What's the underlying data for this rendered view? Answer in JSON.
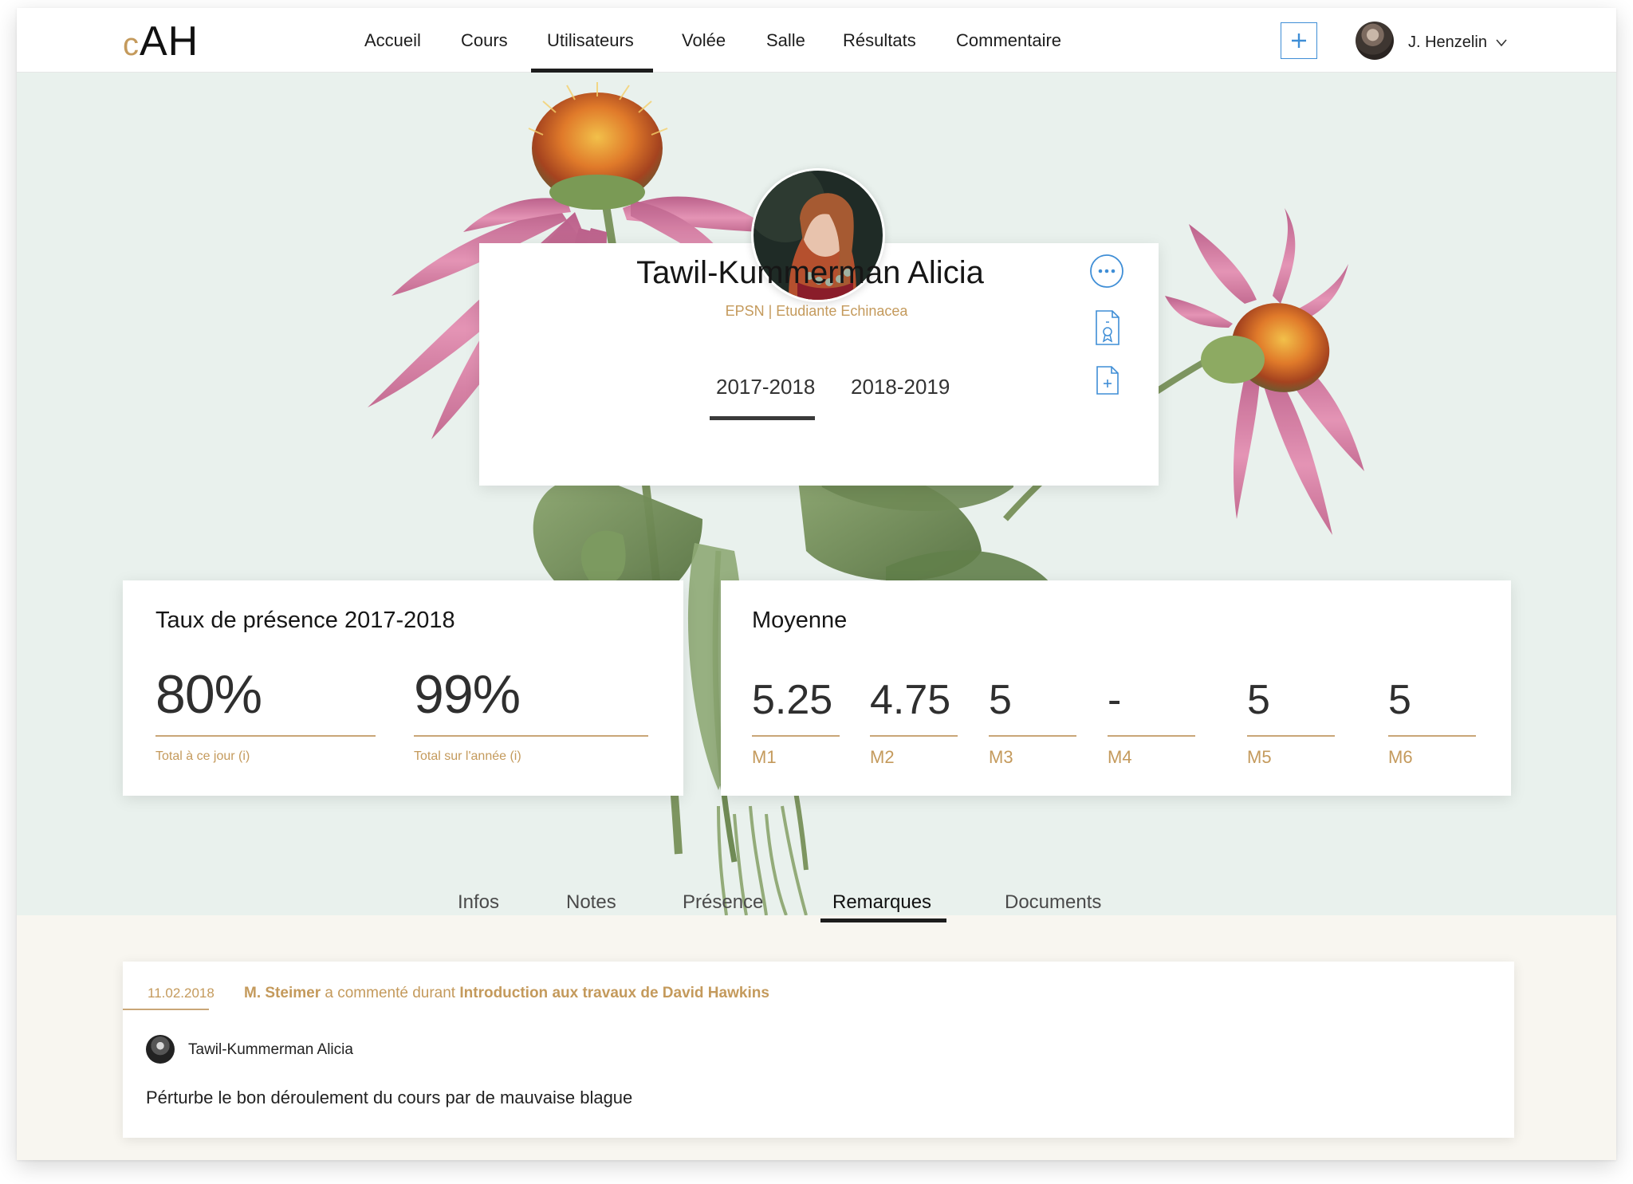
{
  "app": {
    "logo_c": "c",
    "logo_ah": "AH"
  },
  "nav": {
    "items": [
      {
        "label": "Accueil"
      },
      {
        "label": "Cours"
      },
      {
        "label": "Utilisateurs"
      },
      {
        "label": "Volée"
      },
      {
        "label": "Salle"
      },
      {
        "label": "Résultats"
      },
      {
        "label": "Commentaire"
      }
    ],
    "active": "Utilisateurs"
  },
  "header": {
    "add_icon": "plus-icon",
    "user_name": "J. Henzelin",
    "user_menu_icon": "chevron-down-icon"
  },
  "profile": {
    "name": "Tawil-Kummerman Alicia",
    "subtitle": "EPSN | Etudiante Echinacea",
    "years": [
      "2017-2018",
      "2018-2019"
    ],
    "active_year": "2017-2018",
    "actions": [
      "more-options-icon",
      "certificate-document-icon",
      "add-document-icon"
    ]
  },
  "attendance": {
    "title": "Taux de présence 2017-2018",
    "items": [
      {
        "value": "80%",
        "caption": "Total à ce jour (i)"
      },
      {
        "value": "99%",
        "caption": "Total sur l'année (i)"
      }
    ]
  },
  "average": {
    "title": "Moyenne",
    "items": [
      {
        "value": "5.25",
        "label": "M1"
      },
      {
        "value": "4.75",
        "label": "M2"
      },
      {
        "value": "5",
        "label": "M3"
      },
      {
        "value": "-",
        "label": "M4"
      },
      {
        "value": "5",
        "label": "M5"
      },
      {
        "value": "5",
        "label": "M6"
      }
    ]
  },
  "tabs": {
    "items": [
      {
        "label": "Infos"
      },
      {
        "label": "Notes"
      },
      {
        "label": "Présence"
      },
      {
        "label": "Remarques"
      },
      {
        "label": "Documents"
      }
    ],
    "active": "Remarques"
  },
  "remark": {
    "date": "11.02.2018",
    "author": "M. Steimer",
    "action_text": " a commenté durant ",
    "course": "Introduction aux travaux de David Hawkins",
    "student": "Tawil-Kummerman Alicia",
    "text": "Pérturbe le bon déroulement du cours par de mauvaise blague"
  },
  "colors": {
    "accent_gold": "#c49a5c",
    "accent_blue": "#3f8ed6",
    "hero_bg": "#e9f1ed",
    "lower_bg": "#f8f6f0"
  }
}
